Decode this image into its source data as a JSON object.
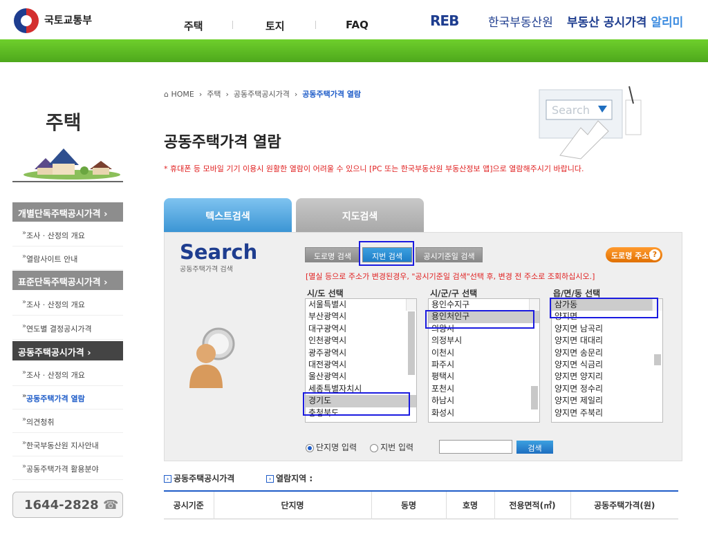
{
  "header": {
    "ministry": "국토교통부",
    "nav": [
      "주택",
      "토지",
      "FAQ"
    ],
    "reb_logo": "REB",
    "reb_name": "한국부동산원",
    "site_title_a": "부동산 공시가격",
    "site_title_b": "알리미"
  },
  "sidebar": {
    "title": "주택",
    "menu": [
      {
        "label": "개별단독주택공시가격  ›",
        "type": "head"
      },
      {
        "label": "조사 · 산정의 개요",
        "type": "item"
      },
      {
        "label": "열람사이트 안내",
        "type": "item"
      },
      {
        "label": "표준단독주택공시가격  ›",
        "type": "head"
      },
      {
        "label": "조사 · 산정의 개요",
        "type": "item"
      },
      {
        "label": "연도별 결정공시가격",
        "type": "item"
      },
      {
        "label": "공동주택공시가격       ›",
        "type": "head-active"
      },
      {
        "label": "조사 · 산정의 개요",
        "type": "item"
      },
      {
        "label": "공동주택가격 열람",
        "type": "item-current"
      },
      {
        "label": "의견청취",
        "type": "item"
      },
      {
        "label": "한국부동산원 지사안내",
        "type": "item"
      },
      {
        "label": "공동주택가격 활용분야",
        "type": "item"
      }
    ],
    "phone": "1644-2828"
  },
  "breadcrumb": {
    "home": "HOME",
    "items": [
      "주택",
      "공동주택공시가격"
    ],
    "current": "공동주택가격 열람"
  },
  "page_title": "공동주택가격 열람",
  "notice": "* 휴대폰 등 모바일 기기 이용시 원활한 열람이 어려울 수 있으니 [PC 또는 한국부동산원 부동산정보 앱]으로 열람해주시기 바랍니다.",
  "tabs": [
    "텍스트검색",
    "지도검색"
  ],
  "search": {
    "word": "Search",
    "sub": "공동주택가격 검색",
    "buttons": [
      "도로명 검색",
      "지번 검색",
      "공시기준일 검색"
    ],
    "addr_button": "도로명 주소란",
    "red_note": "[멸실 등으로 주소가 변경된경우, \"공시기준일 검색\"선택 후, 변경 전 주소로 조회하십시오.]",
    "columns": [
      "시/도 선택",
      "시/군/구 선택",
      "읍/면/동 선택"
    ],
    "sido": [
      "서울특별시",
      "부산광역시",
      "대구광역시",
      "인천광역시",
      "광주광역시",
      "대전광역시",
      "울산광역시",
      "세종특별자치시",
      "경기도",
      "충청북도"
    ],
    "sido_selected": 8,
    "sigungu": [
      "용인수지구",
      "용인처인구",
      "의왕시",
      "의정부시",
      "이천시",
      "파주시",
      "평택시",
      "포천시",
      "하남시",
      "화성시"
    ],
    "sigungu_selected": 1,
    "emd": [
      "삼가동",
      "양지면",
      "양지면 남곡리",
      "양지면 대대리",
      "양지면 송문리",
      "양지면 식금리",
      "양지면 양지리",
      "양지면 정수리",
      "양지면 제일리",
      "양지면 주북리"
    ],
    "emd_selected": 0,
    "radio": [
      "단지명 입력",
      "지번 입력"
    ],
    "search_button": "검색"
  },
  "result": {
    "meta_a": "공동주택공시가격",
    "meta_b": "열람지역 :",
    "columns": [
      "공시기준",
      "단지명",
      "동명",
      "호명",
      "전용면적(㎡)",
      "공동주택가격(원)"
    ]
  }
}
